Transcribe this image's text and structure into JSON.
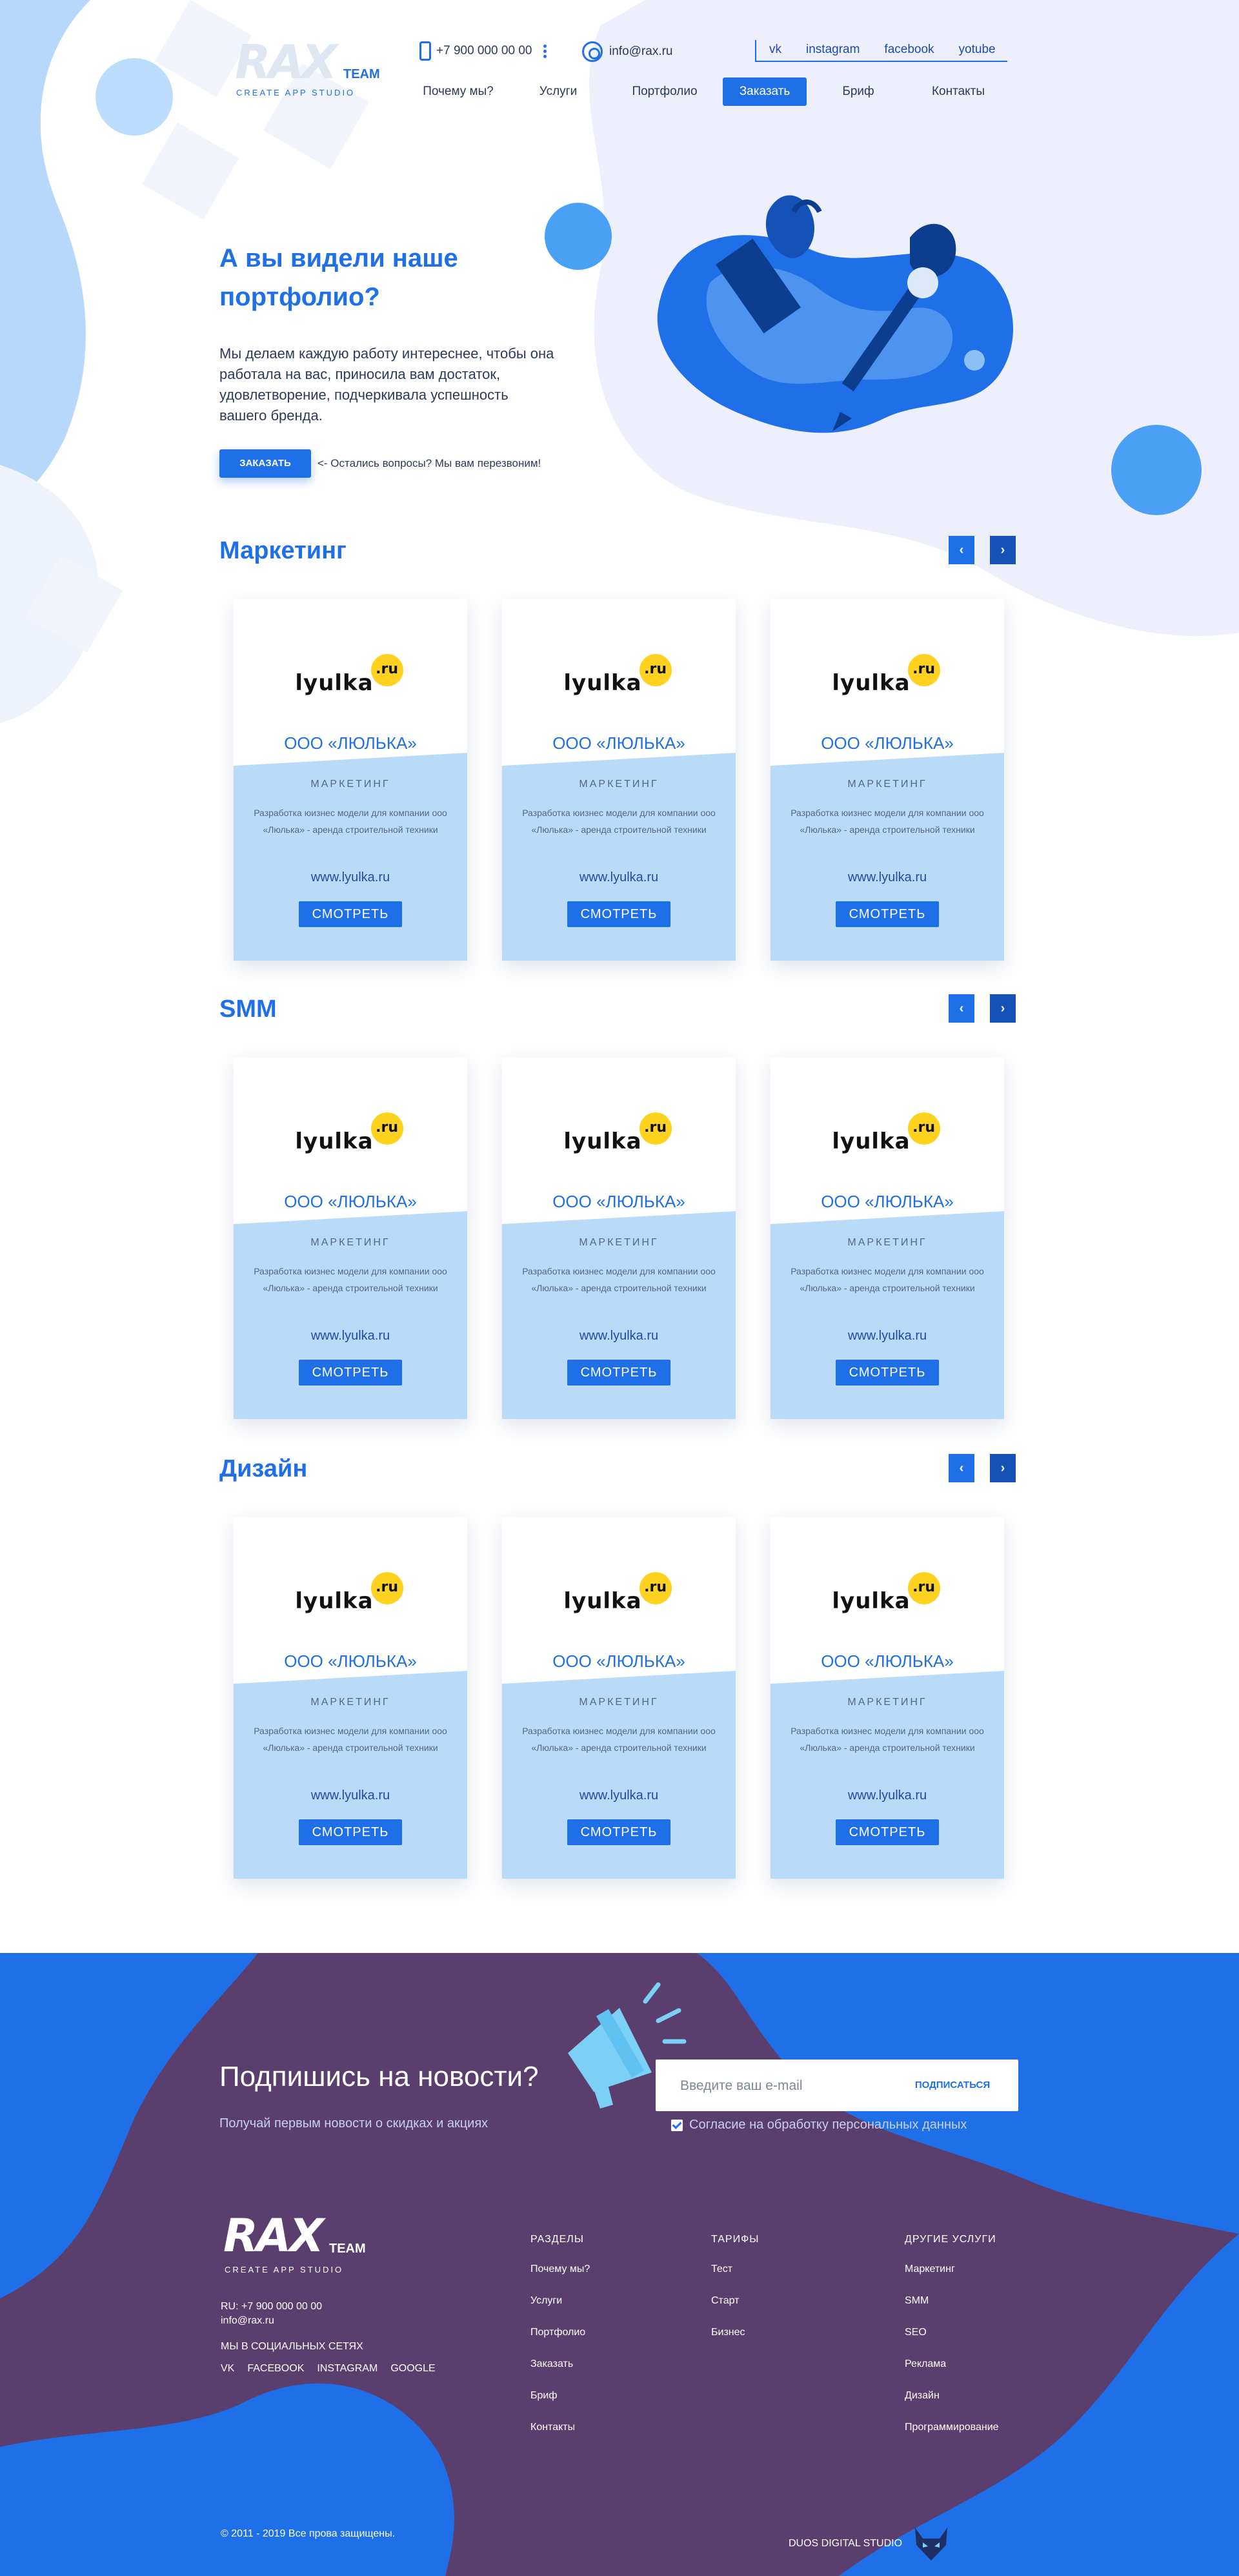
{
  "header": {
    "logo_text": "RAX",
    "logo_team": "TEAM",
    "logo_sub": "CREATE APP STUDIO",
    "phone": "+7 900 000 00 00",
    "email": "info@rax.ru",
    "socials": [
      "vk",
      "instagram",
      "facebook",
      "yotube"
    ],
    "nav": [
      {
        "label": "Почему мы?",
        "active": false
      },
      {
        "label": "Услуги",
        "active": false
      },
      {
        "label": "Портфолио",
        "active": false
      },
      {
        "label": "Заказать",
        "active": true
      },
      {
        "label": "Бриф",
        "active": false
      },
      {
        "label": "Контакты",
        "active": false
      }
    ]
  },
  "hero": {
    "title": "А вы видели наше портфолио?",
    "text": "Мы делаем каждую работу интереснее, чтобы она работала на вас, приносила вам достаток, удовлетворение, подчеркивала успешность вашего бренда.",
    "button": "ЗАКАЗАТЬ",
    "note": "<- Остались вопросы? Мы вам перезвоним!"
  },
  "sections": [
    {
      "title": "Маркетинг",
      "cards": [
        {
          "logo": "lyulka",
          "logo_badge": ".ru",
          "company": "ООО «ЛЮЛЬКА»",
          "category": "МАРКЕТИНГ",
          "description": "Разработка юизнес модели для компании ооо «Люлька» - аренда строительной техники",
          "url": "www.lyulka.ru",
          "button": "СМОТРЕТЬ"
        },
        {
          "logo": "lyulka",
          "logo_badge": ".ru",
          "company": "ООО «ЛЮЛЬКА»",
          "category": "МАРКЕТИНГ",
          "description": "Разработка юизнес модели для компании ооо «Люлька» - аренда строительной техники",
          "url": "www.lyulka.ru",
          "button": "СМОТРЕТЬ"
        },
        {
          "logo": "lyulka",
          "logo_badge": ".ru",
          "company": "ООО «ЛЮЛЬКА»",
          "category": "МАРКЕТИНГ",
          "description": "Разработка юизнес модели для компании ооо «Люлька» - аренда строительной техники",
          "url": "www.lyulka.ru",
          "button": "СМОТРЕТЬ"
        }
      ]
    },
    {
      "title": "SMM",
      "cards": [
        {
          "logo": "lyulka",
          "logo_badge": ".ru",
          "company": "ООО «ЛЮЛЬКА»",
          "category": "МАРКЕТИНГ",
          "description": "Разработка юизнес модели для компании ооо «Люлька» - аренда строительной техники",
          "url": "www.lyulka.ru",
          "button": "СМОТРЕТЬ"
        },
        {
          "logo": "lyulka",
          "logo_badge": ".ru",
          "company": "ООО «ЛЮЛЬКА»",
          "category": "МАРКЕТИНГ",
          "description": "Разработка юизнес модели для компании ооо «Люлька» - аренда строительной техники",
          "url": "www.lyulka.ru",
          "button": "СМОТРЕТЬ"
        },
        {
          "logo": "lyulka",
          "logo_badge": ".ru",
          "company": "ООО «ЛЮЛЬКА»",
          "category": "МАРКЕТИНГ",
          "description": "Разработка юизнес модели для компании ооо «Люлька» - аренда строительной техники",
          "url": "www.lyulka.ru",
          "button": "СМОТРЕТЬ"
        }
      ]
    },
    {
      "title": "Дизайн",
      "cards": [
        {
          "logo": "lyulka",
          "logo_badge": ".ru",
          "company": "ООО «ЛЮЛЬКА»",
          "category": "МАРКЕТИНГ",
          "description": "Разработка юизнес модели для компании ооо «Люлька» - аренда строительной техники",
          "url": "www.lyulka.ru",
          "button": "СМОТРЕТЬ"
        },
        {
          "logo": "lyulka",
          "logo_badge": ".ru",
          "company": "ООО «ЛЮЛЬКА»",
          "category": "МАРКЕТИНГ",
          "description": "Разработка юизнес модели для компании ооо «Люлька» - аренда строительной техники",
          "url": "www.lyulka.ru",
          "button": "СМОТРЕТЬ"
        },
        {
          "logo": "lyulka",
          "logo_badge": ".ru",
          "company": "ООО «ЛЮЛЬКА»",
          "category": "МАРКЕТИНГ",
          "description": "Разработка юизнес модели для компании ооо «Люлька» - аренда строительной техники",
          "url": "www.lyulka.ru",
          "button": "СМОТРЕТЬ"
        }
      ]
    }
  ],
  "subscribe": {
    "title": "Подпишись на новости?",
    "text": "Получай первым новости о скидках и акциях",
    "placeholder": "Введите ваш e-mail",
    "button": "ПОДПИСАТЬСЯ",
    "consent": "Согласие на обработку персональных данных"
  },
  "footer": {
    "logo_text": "RAX",
    "logo_team": "TEAM",
    "logo_sub": "CREATE APP STUDIO",
    "phone": "RU: +7 900 000 00 00",
    "email": "info@rax.ru",
    "social_title": "МЫ В СОЦИАЛЬНЫХ СЕТЯХ",
    "socials": [
      "VK",
      "FACEBOOK",
      "INSTAGRAM",
      "GOOGLE"
    ],
    "columns": [
      {
        "title": "РАЗДЕЛЫ",
        "items": [
          "Почему мы?",
          "Услуги",
          "Портфолио",
          "Заказать",
          "Бриф",
          "Контакты"
        ]
      },
      {
        "title": "ТАРИФЫ",
        "items": [
          "Тест",
          "Старт",
          "Бизнес"
        ]
      },
      {
        "title": "ДРУГИЕ УСЛУГИ",
        "items": [
          "Маркетинг",
          "SMM",
          "SEO",
          "Реклама",
          "Дизайн",
          "Программирование"
        ]
      }
    ],
    "copyright": "© 2011 - 2019 Все прова защищены.",
    "studio": "DUOS DIGITAL STUDIO"
  },
  "colors": {
    "accent": "#1f6fe8",
    "accent_dark": "#1452b8",
    "footer_bg": "#5a3f6e",
    "card_lower": "#b9dbf8"
  }
}
